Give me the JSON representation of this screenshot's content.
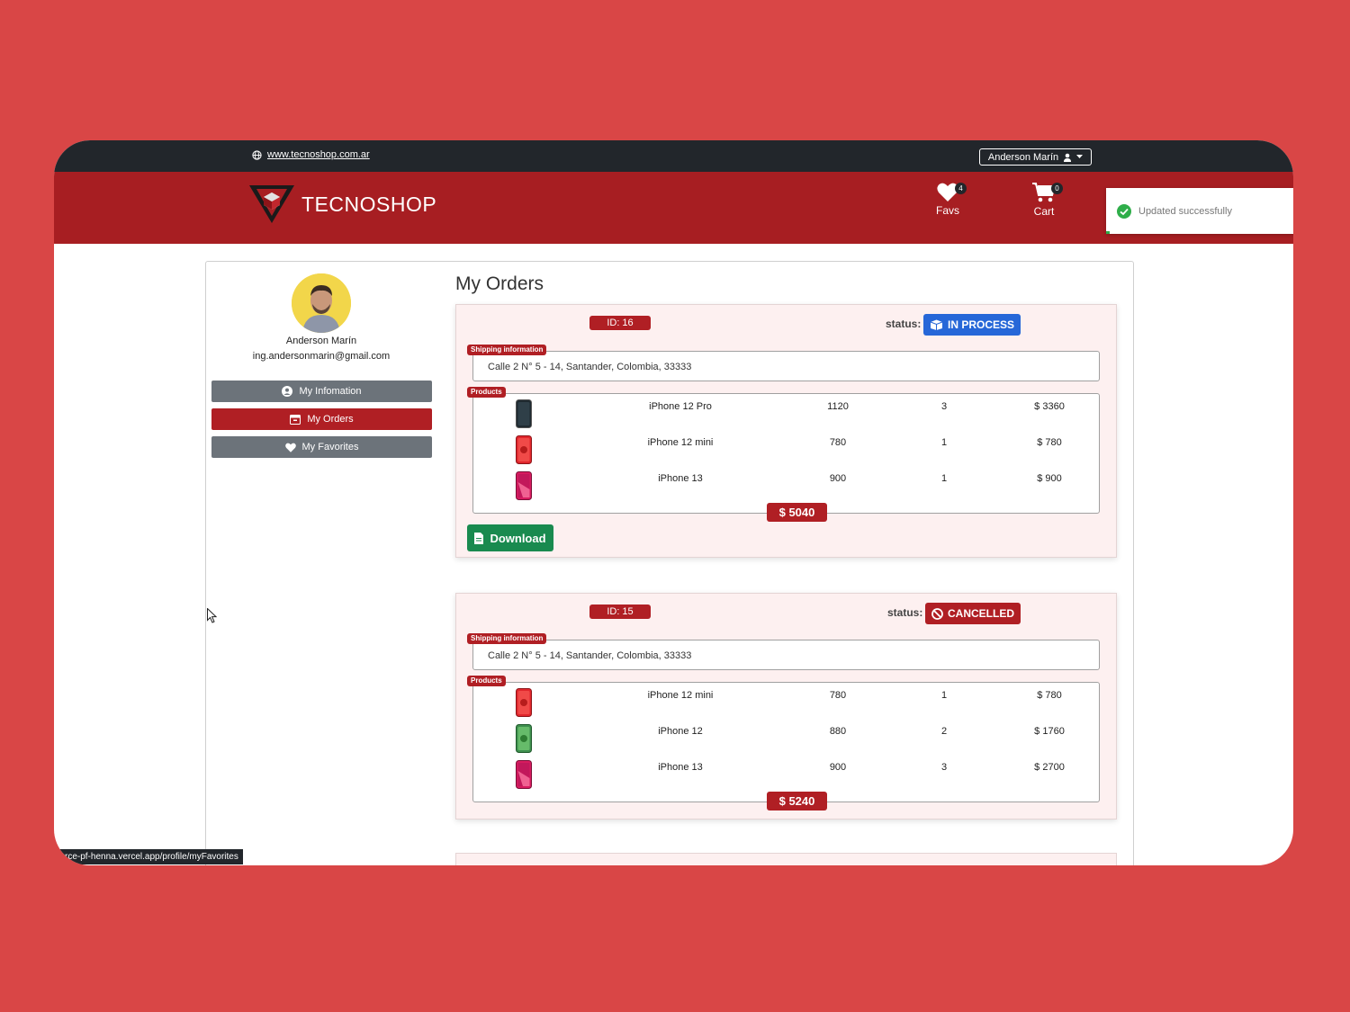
{
  "topbar": {
    "site_url": "www.tecnoshop.com.ar",
    "user_menu_label": "Anderson Marín"
  },
  "header": {
    "brand": "TECNOSHOP",
    "favs_label": "Favs",
    "favs_count": "4",
    "cart_label": "Cart",
    "cart_count": "0"
  },
  "toast": {
    "message": "Updated successfully"
  },
  "profile": {
    "name": "Anderson Marín",
    "email": "ing.andersonmarin@gmail.com"
  },
  "sidebar": {
    "items": [
      {
        "label": "My Infomation"
      },
      {
        "label": "My Orders"
      },
      {
        "label": "My Favorites"
      }
    ]
  },
  "page_title": "My Orders",
  "orders": [
    {
      "id_label": "ID: 16",
      "status_label": "status:",
      "status": "IN PROCESS",
      "status_color": "#2667d8",
      "shipping_tag": "Shipping information",
      "address": "Calle 2 N° 5 - 14, Santander, Colombia, 33333",
      "products_tag": "Products",
      "products": [
        {
          "name": "iPhone 12 Pro",
          "price": "1120",
          "qty": "3",
          "total": "$ 3360",
          "color": "#1f2a30"
        },
        {
          "name": "iPhone 12 mini",
          "price": "780",
          "qty": "1",
          "total": "$ 780",
          "color": "#e0262c"
        },
        {
          "name": "iPhone 13",
          "price": "900",
          "qty": "1",
          "total": "$ 900",
          "color": "#d81b60"
        }
      ],
      "total": "$ 5040",
      "download_label": "Download"
    },
    {
      "id_label": "ID: 15",
      "status_label": "status:",
      "status": "CANCELLED",
      "status_color": "#b01f24",
      "shipping_tag": "Shipping information",
      "address": "Calle 2 N° 5 - 14, Santander, Colombia, 33333",
      "products_tag": "Products",
      "products": [
        {
          "name": "iPhone 12 mini",
          "price": "780",
          "qty": "1",
          "total": "$ 780",
          "color": "#e0262c"
        },
        {
          "name": "iPhone 12",
          "price": "880",
          "qty": "2",
          "total": "$ 1760",
          "color": "#4caf50"
        },
        {
          "name": "iPhone 13",
          "price": "900",
          "qty": "3",
          "total": "$ 2700",
          "color": "#d81b60"
        }
      ],
      "total": "$ 5240"
    }
  ],
  "status_bar_url": "rce-pf-henna.vercel.app/profile/myFavorites"
}
